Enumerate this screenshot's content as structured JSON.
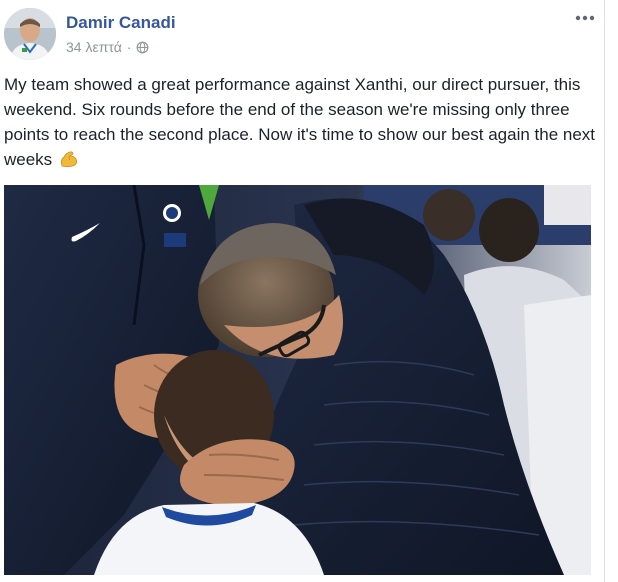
{
  "post": {
    "author_name": "Damir Canadi",
    "timestamp": "34 λεπτά",
    "separator": "·",
    "audience_icon": "globe-icon",
    "more_icon": "more-options-icon",
    "text": "My team showed a great performance against Xanthi, our direct pursuer, this weekend. Six rounds before the end of the season we're missing only three points to reach the second place. Now it's time to show our best again the next weeks",
    "emoji": "flexed-biceps-emoji",
    "photo": "coach-hugging-young-player-photo"
  },
  "colors": {
    "author_link": "#365899",
    "meta_gray": "#90949c",
    "body_text": "#1d2129",
    "divider": "#dddfe2"
  }
}
